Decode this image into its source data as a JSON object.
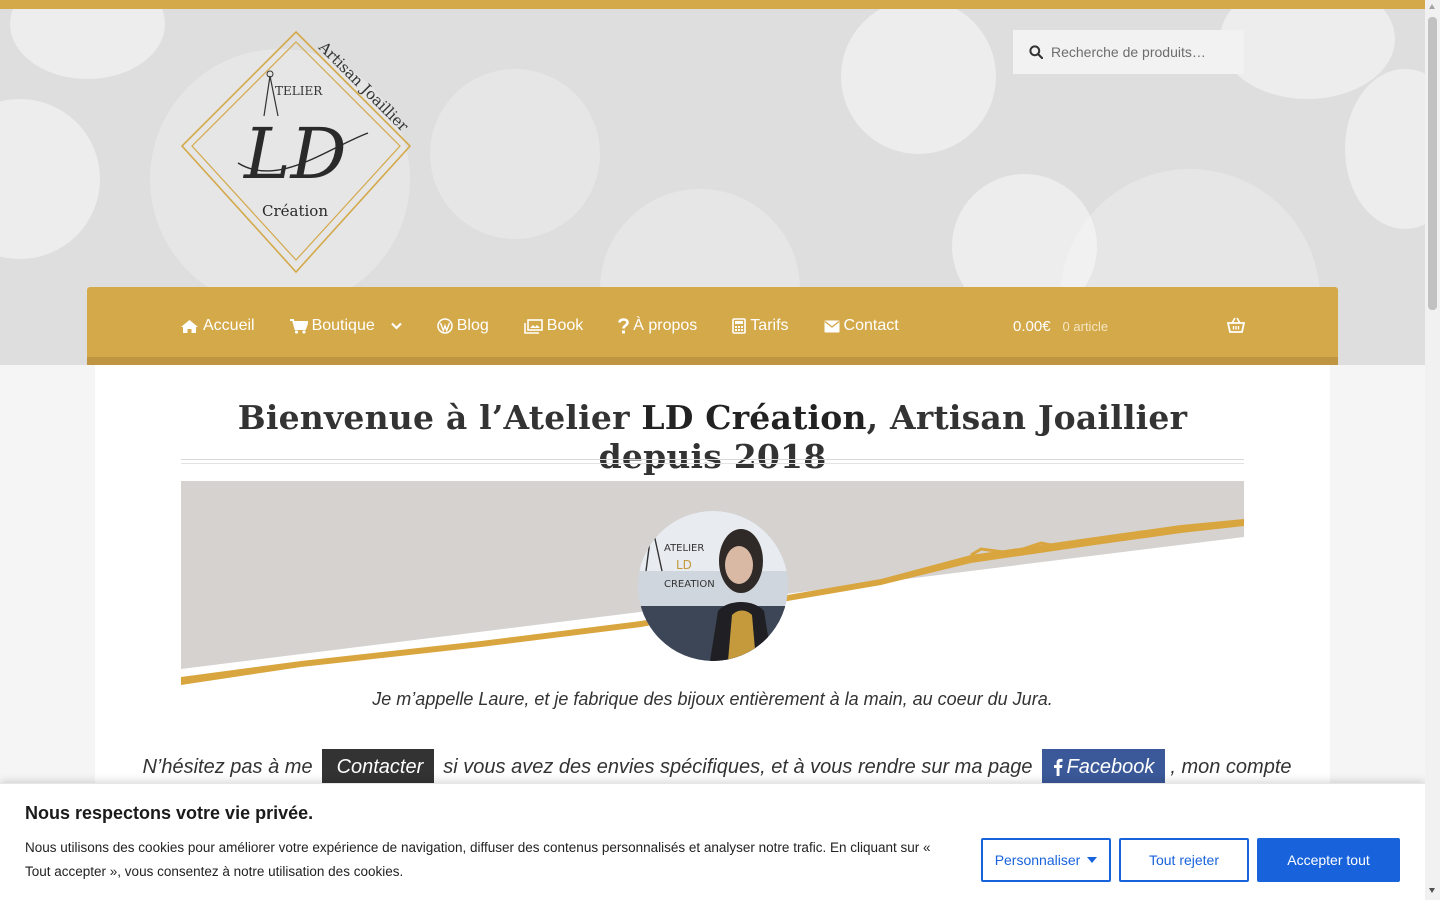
{
  "header": {
    "search_placeholder": "Recherche de produits…",
    "logo_text": {
      "top": "Artisan Joaillier",
      "atelier": "TELIER",
      "monogram": "LD",
      "bottom": "Création"
    }
  },
  "nav": {
    "items": [
      {
        "label": "Accueil",
        "icon": "home-icon"
      },
      {
        "label": "Boutique",
        "icon": "shopping-cart-icon"
      },
      {
        "label": "Blog",
        "icon": "wordpress-icon"
      },
      {
        "label": "Book",
        "icon": "images-icon"
      },
      {
        "label": "À propos",
        "icon": "question-icon"
      },
      {
        "label": "Tarifs",
        "icon": "calculator-icon"
      },
      {
        "label": "Contact",
        "icon": "envelope-icon"
      }
    ],
    "cart_amount": "0.00€",
    "cart_count": "0 article"
  },
  "main": {
    "title_pre": "Bienvenue à l’Atelier ",
    "title_bold": "LD Création",
    "title_post": ", Artisan Joaillier depuis 2018",
    "avatar_text": {
      "line1": "ATELIER",
      "line2": "LD",
      "line3": "CREATION"
    },
    "intro": "Je m’appelle Laure, et je fabrique des bijoux entièrement à la main, au coeur du Jura.",
    "cta_pre": "N’hésitez pas à me",
    "contact_button": "Contacter",
    "contact_icon_glyph": "",
    "cta_mid": "si vous avez des envies spécifiques, et à vous rendre sur ma page",
    "facebook_button": "Facebook",
    "cta_post": ", mon compte"
  },
  "cookie": {
    "title": "Nous respectons votre vie privée.",
    "text": "Nous utilisons des cookies pour améliorer votre expérience de navigation, diffuser des contenus personnalisés et analyser notre trafic. En cliquant sur « Tout accepter », vous consentez à notre utilisation des cookies.",
    "customize": "Personnaliser",
    "reject": "Tout rejeter",
    "accept": "Accepter tout"
  },
  "colors": {
    "gold": "#d4a94a",
    "cookie_blue": "#1863dc",
    "facebook_blue": "#3b5998"
  }
}
